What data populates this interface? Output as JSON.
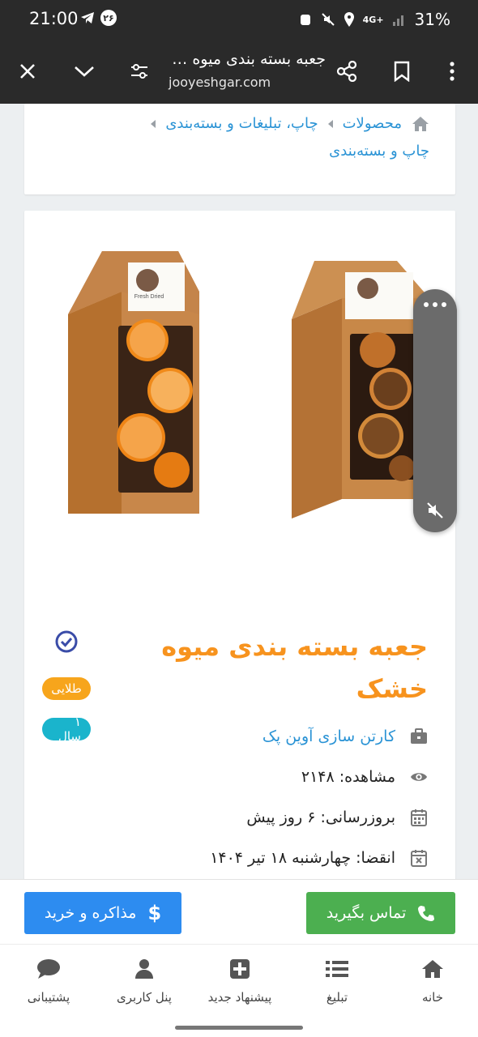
{
  "status_bar": {
    "time": "21:00",
    "notif_badge": "۲۶",
    "network": "4G+",
    "battery": "31%"
  },
  "toolbar": {
    "title": "جعبه بسته بندی میوه خشک",
    "url": "jooyeshgar.com"
  },
  "breadcrumb": {
    "items": [
      "محصولات",
      "چاپ، تبلیغات و بسته‌بندی",
      "چاپ و بسته‌بندی"
    ]
  },
  "product": {
    "title": "جعبه بسته بندی میوه خشک",
    "badge_gold": "طلایی",
    "badge_year": "۱ سال",
    "company": "کارتن سازی آوین پک",
    "views": "مشاهده: ۲۱۴۸",
    "updated": "بروزرسانی: ۶ روز پیش",
    "expires": "انقضا: چهارشنبه ۱۸ تیر ۱۴۰۴",
    "box_label": "Fresh Dried",
    "icons": {
      "company": "briefcase-icon",
      "views": "eye-icon",
      "updated": "calendar-icon",
      "expires": "calendar-x-icon"
    }
  },
  "actions": {
    "call_label": "تماس بگیرید",
    "buy_label": "مذاکره و خرید"
  },
  "bottom_nav": {
    "items": [
      "خانه",
      "تبلیغ",
      "پیشنهاد جدید",
      "پنل کاربری",
      "پشتیبانی"
    ]
  },
  "colors": {
    "accent_orange": "#f7931e",
    "link_blue": "#2a93d5",
    "gold": "#f7a51c",
    "year": "#1ab4cc",
    "call_green": "#4caf50",
    "buy_blue": "#2d8cf0"
  }
}
